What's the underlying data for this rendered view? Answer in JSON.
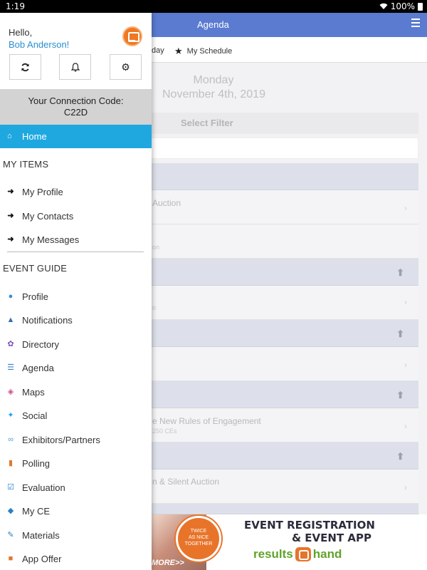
{
  "status": {
    "time": "1:19",
    "battery": "100%"
  },
  "app": {
    "title": "Agenda",
    "tabs": {
      "today_partial": "day",
      "my_schedule": "My Schedule"
    },
    "day": "Monday",
    "date": "November 4th, 2019",
    "filter_label": "Select Filter",
    "rows": {
      "r1_title": "Auction",
      "r1_sub": "on",
      "r2_sub": "n",
      "r3_title": "e New Rules of Engagement",
      "r3_sub": "250 CEs",
      "r4_title": "n & Silent Auction"
    }
  },
  "banner": {
    "more": "MORE>>",
    "badge": [
      "TWICE",
      "AS NICE",
      "TOGETHER"
    ],
    "line1": "EVENT REGISTRATION",
    "line2": "& EVENT APP",
    "brand_left": "results",
    "brand_right": "hand"
  },
  "drawer": {
    "greeting": "Hello,",
    "user_name": "Bob Anderson!",
    "connection_label": "Your Connection Code:",
    "connection_code": "C22D",
    "home_label": "Home",
    "my_items_header": "MY ITEMS",
    "my_items": [
      {
        "label": "My Profile"
      },
      {
        "label": "My Contacts"
      },
      {
        "label": "My Messages"
      }
    ],
    "event_guide_header": "EVENT GUIDE",
    "event_guide": [
      {
        "label": "Profile",
        "icon": "person-icon",
        "color": "#3a8fd0"
      },
      {
        "label": "Notifications",
        "icon": "warning-icon",
        "color": "#2f6fb3"
      },
      {
        "label": "Directory",
        "icon": "people-icon",
        "color": "#7c4fc4"
      },
      {
        "label": "Agenda",
        "icon": "list-icon",
        "color": "#3a7fc8"
      },
      {
        "label": "Maps",
        "icon": "map-icon",
        "color": "#d04a8a"
      },
      {
        "label": "Social",
        "icon": "twitter-icon",
        "color": "#1da1f2"
      },
      {
        "label": "Exhibitors/Partners",
        "icon": "handshake-icon",
        "color": "#4aa0d8"
      },
      {
        "label": "Polling",
        "icon": "bar-chart-icon",
        "color": "#e07a2a"
      },
      {
        "label": "Evaluation",
        "icon": "checkbox-icon",
        "color": "#2f7fd0"
      },
      {
        "label": "My CE",
        "icon": "graduation-cap-icon",
        "color": "#2a7fc8"
      },
      {
        "label": "Materials",
        "icon": "paperclip-icon",
        "color": "#2a7fc8"
      },
      {
        "label": "App Offer",
        "icon": "app-offer-icon",
        "color": "#e8742a"
      }
    ]
  }
}
